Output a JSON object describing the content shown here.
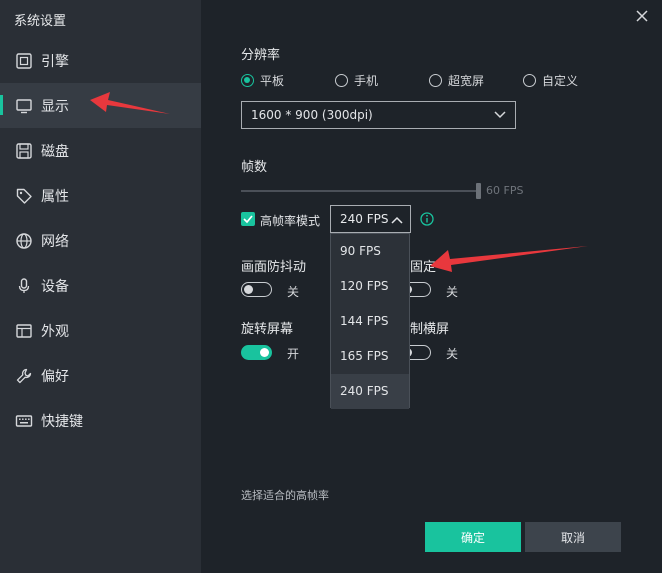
{
  "window": {
    "title": "系统设置"
  },
  "sidebar": {
    "items": [
      {
        "label": "引擎",
        "icon": "engine-icon"
      },
      {
        "label": "显示",
        "icon": "display-icon",
        "active": true
      },
      {
        "label": "磁盘",
        "icon": "disk-icon"
      },
      {
        "label": "属性",
        "icon": "tag-icon"
      },
      {
        "label": "网络",
        "icon": "globe-icon"
      },
      {
        "label": "设备",
        "icon": "microphone-icon"
      },
      {
        "label": "外观",
        "icon": "window-icon"
      },
      {
        "label": "偏好",
        "icon": "wrench-icon"
      },
      {
        "label": "快捷键",
        "icon": "keyboard-icon"
      }
    ]
  },
  "resolution": {
    "title": "分辨率",
    "options": [
      {
        "label": "平板",
        "checked": true
      },
      {
        "label": "手机",
        "checked": false
      },
      {
        "label": "超宽屏",
        "checked": false
      },
      {
        "label": "自定义",
        "checked": false
      }
    ],
    "selected": "1600 * 900 (300dpi)"
  },
  "framerate": {
    "title": "帧数",
    "slider_value": "60 FPS",
    "slider_fraction": 1.0,
    "high_fps_label": "高帧率模式",
    "high_fps_checked": true,
    "fps_selected": "240 FPS",
    "fps_options": [
      "90 FPS",
      "120 FPS",
      "144 FPS",
      "165 FPS",
      "240 FPS"
    ]
  },
  "settings": {
    "anti_shake": {
      "label": "画面防抖动",
      "state": "关"
    },
    "lock_partial": {
      "label": "固定",
      "state": "关"
    },
    "rotate": {
      "label": "旋转屏幕",
      "state": "开"
    },
    "force_partial": {
      "label": "制横屏",
      "state": "关"
    }
  },
  "hint": "选择适合的高帧率",
  "buttons": {
    "ok": "确定",
    "cancel": "取消"
  },
  "colors": {
    "accent": "#19c39e",
    "annotation": "#e8383d"
  }
}
